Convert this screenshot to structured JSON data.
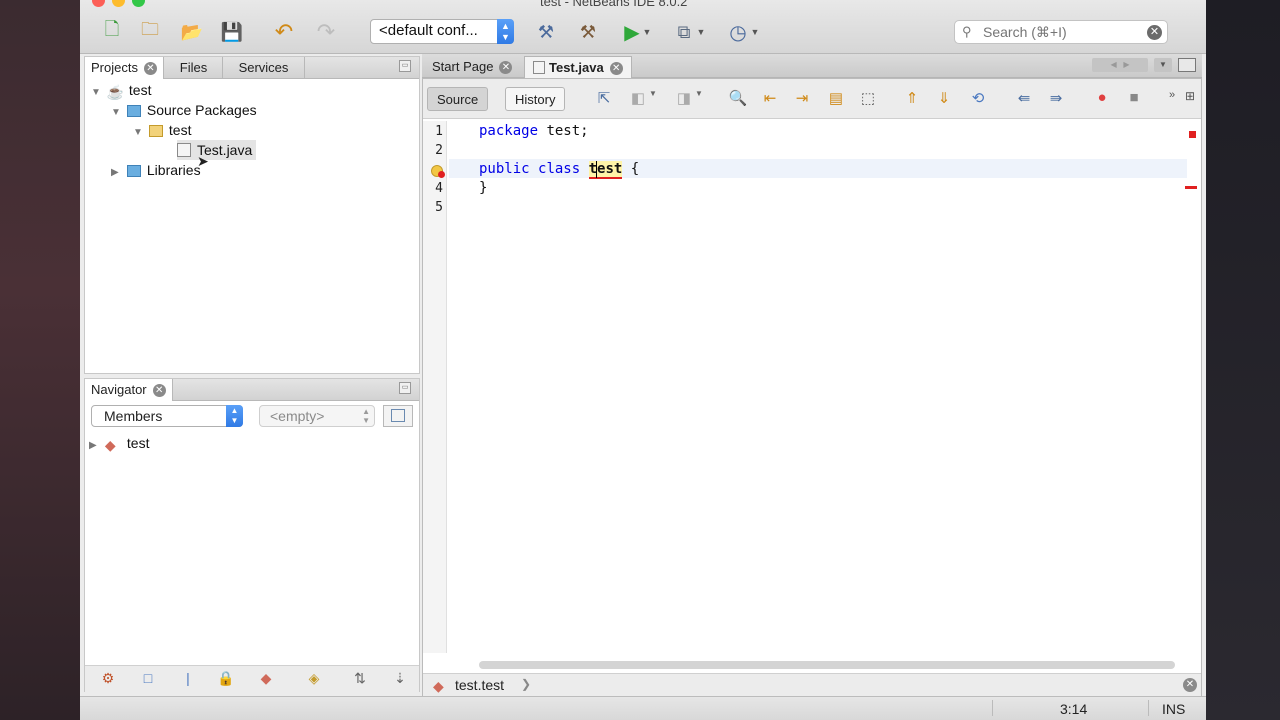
{
  "window": {
    "title": "test - NetBeans IDE 8.0.2"
  },
  "toolbar": {
    "config_value": "<default conf...",
    "search_placeholder": "Search (⌘+I)"
  },
  "projects_panel": {
    "tabs": [
      {
        "label": "Projects"
      },
      {
        "label": "Files"
      },
      {
        "label": "Services"
      }
    ],
    "tree": {
      "project": "test",
      "source_packages": "Source Packages",
      "package": "test",
      "file": "Test.java",
      "libraries": "Libraries"
    }
  },
  "navigator": {
    "title": "Navigator",
    "members_value": "Members",
    "filter_value": "<empty>",
    "tree_item": "test"
  },
  "editor": {
    "tabs": [
      {
        "label": "Start Page"
      },
      {
        "label": "Test.java"
      }
    ],
    "source_label": "Source",
    "history_label": "History",
    "line_numbers": [
      "1",
      "2",
      "3",
      "4",
      "5"
    ],
    "code": {
      "line1_kw": "package",
      "line1_rest": " test;",
      "line3_kw1": "public",
      "line3_kw2": "class",
      "line3_name": "test",
      "line3_rest": " {",
      "line4": "}"
    },
    "breadcrumb": "test.test"
  },
  "statusbar": {
    "position": "3:14",
    "mode": "INS"
  }
}
